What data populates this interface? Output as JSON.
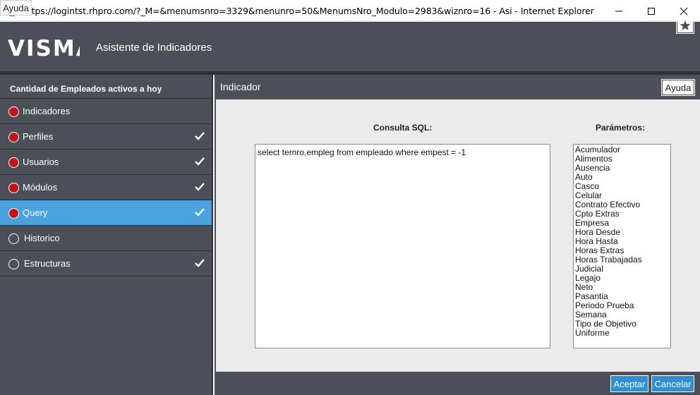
{
  "window": {
    "title": "https://logintst.rhpro.com/?_M=&menumsnro=3329&menunro=50&MenumsNro_Modulo=2983&wiznro=16 - Asi - Internet Explorer",
    "min_icon": "minimize-icon",
    "max_icon": "maximize-icon",
    "close_icon": "close-icon"
  },
  "header": {
    "logo": "VISMA",
    "app_title": "Asistente de Indicadores",
    "help_label": "Ayuda",
    "favorite_icon": "star-icon"
  },
  "sidebar": {
    "heading": "Cantidad de Empleados activos a hoy",
    "items": [
      {
        "label": "Indicadores",
        "status": "red",
        "checked": false,
        "active": false
      },
      {
        "label": "Perfiles",
        "status": "red",
        "checked": true,
        "active": false
      },
      {
        "label": "Usuarios",
        "status": "red",
        "checked": true,
        "active": false
      },
      {
        "label": "Módulos",
        "status": "red",
        "checked": true,
        "active": false
      },
      {
        "label": "Query",
        "status": "red",
        "checked": true,
        "active": true
      },
      {
        "label": "Historico",
        "status": "empty",
        "checked": false,
        "active": false
      },
      {
        "label": "Estructuras",
        "status": "empty",
        "checked": true,
        "active": false
      }
    ]
  },
  "panel": {
    "title": "Indicador",
    "help_label": "Ayuda",
    "sql_label": "Consulta SQL:",
    "sql_value": "select ternro,empleg from empleado where empest = -1",
    "params_label": "Parámetros:",
    "params": [
      "Acumulador",
      "Alimentos",
      "Ausencia",
      "Auto",
      "Casco",
      "Celular",
      "Contrato Efectivo",
      "Cpto Extras",
      "Empresa",
      "Hora Desde",
      "Hora Hasta",
      "Horas Extras",
      "Horas Trabajadas",
      "Judicial",
      "Legajo",
      "Neto",
      "Pasantia",
      "Periodo Prueba",
      "Semana",
      "Tipo de Objetivo",
      "Uniforme"
    ]
  },
  "footer": {
    "accept_label": "Aceptar",
    "cancel_label": "Cancelar"
  },
  "colors": {
    "header_bg": "#4c4f57",
    "active_item": "#4aa3df",
    "status_red": "#c0141b",
    "button_blue": "#2e8fd6"
  }
}
